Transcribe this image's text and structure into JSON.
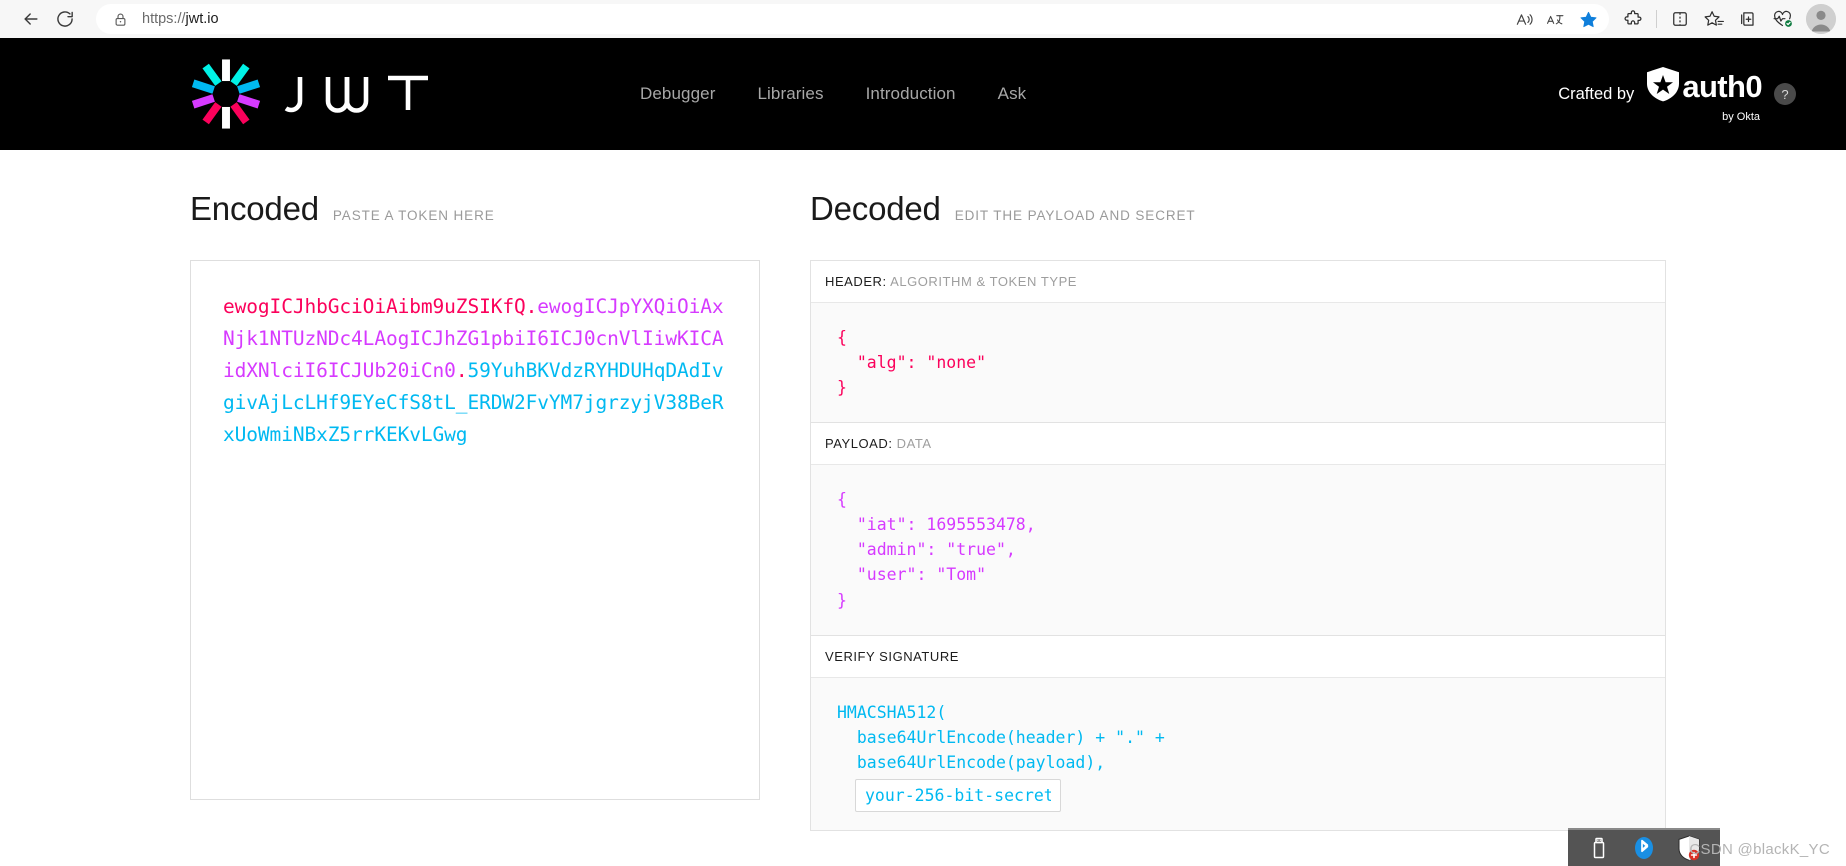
{
  "browser": {
    "back_tooltip": "Back",
    "refresh_tooltip": "Refresh",
    "url_scheme": "https://",
    "url_host": "jwt.io",
    "url_full": "https://jwt.io",
    "icons": {
      "lock": "lock-icon",
      "read_aloud": "read-aloud-icon",
      "translate": "translate-icon",
      "favorite_filled": "favorite-filled-icon",
      "extensions": "extensions-icon",
      "split_screen": "split-screen-icon",
      "favorites": "favorites-icon",
      "collections": "collections-icon",
      "browser_essentials": "browser-essentials-icon",
      "profile": "profile-avatar-icon"
    }
  },
  "site": {
    "logo_alt": "JWT",
    "logo_word": "JWT",
    "nav": [
      {
        "label": "Debugger"
      },
      {
        "label": "Libraries"
      },
      {
        "label": "Introduction"
      },
      {
        "label": "Ask"
      }
    ],
    "crafted_by": "Crafted by",
    "brand": "auth0",
    "brand_sub": "by Okta",
    "help_badge": "?"
  },
  "encoded": {
    "title": "Encoded",
    "subtitle": "PASTE A TOKEN HERE",
    "token": {
      "header": "ewogICJhbGciOiAibm9uZSIKfQ",
      "payload": "ewogICJpYXQiOiAxNjk1NTUzNDc4LAogICJhZG1pbiI6ICJ0cnVlIiwKICAidXNlciI6ICJUb20iCn0",
      "signature": "59YuhBKVdzRYHDUHqDAdIvgivAjLcLHf9EYeCfS8tL_ERDW2FvYM7jgrzyjV38BeRxUoWmiNBxZ5rrKEKvLGwg",
      "separator": "."
    }
  },
  "decoded": {
    "title": "Decoded",
    "subtitle": "EDIT THE PAYLOAD AND SECRET",
    "header_panel": {
      "label": "HEADER:",
      "label_muted": "ALGORITHM & TOKEN TYPE",
      "json": "{\n  \"alg\": \"none\"\n}"
    },
    "payload_panel": {
      "label": "PAYLOAD:",
      "label_muted": "DATA",
      "json": "{\n  \"iat\": 1695553478,\n  \"admin\": \"true\",\n  \"user\": \"Tom\"\n}"
    },
    "signature_panel": {
      "label": "VERIFY SIGNATURE",
      "line1": "HMACSHA512(",
      "line2": "  base64UrlEncode(header) + \".\" +",
      "line3": "  base64UrlEncode(payload),",
      "secret_value": "your-256-bit-secret"
    }
  },
  "tray": {
    "icons": [
      {
        "name": "usb-icon"
      },
      {
        "name": "bluetooth-icon"
      },
      {
        "name": "windows-defender-icon"
      }
    ]
  },
  "watermark": "CSDN @blackK_YC",
  "colors": {
    "jwt_header": "#fb015b",
    "jwt_payload": "#d63aff",
    "jwt_signature": "#00b9f1",
    "header_bg": "#000000",
    "edge_blue": "#0078d4"
  }
}
